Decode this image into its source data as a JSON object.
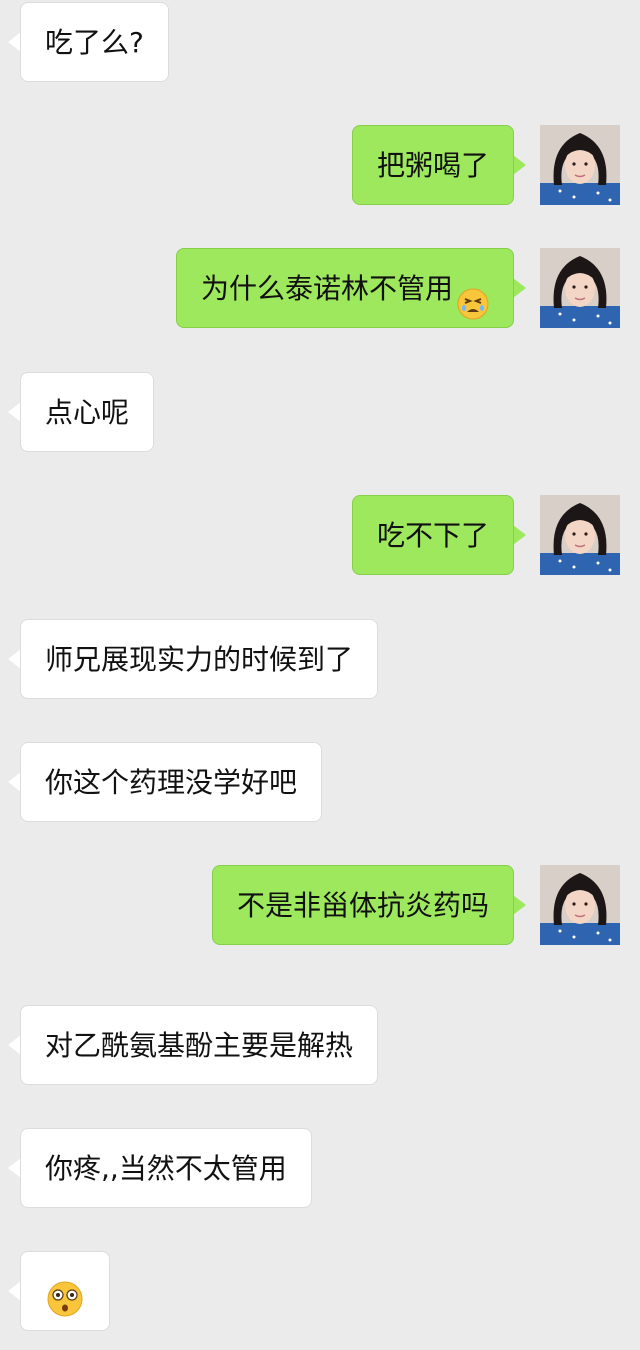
{
  "messages": [
    {
      "side": "left",
      "text": "吃了么?"
    },
    {
      "side": "right",
      "text": "把粥喝了"
    },
    {
      "side": "right",
      "text": "为什么泰诺林不管用",
      "emoji": "tired-face-emoji"
    },
    {
      "side": "left",
      "text": "点心呢"
    },
    {
      "side": "right",
      "text": "吃不下了"
    },
    {
      "side": "left",
      "text": "师兄展现实力的时候到了"
    },
    {
      "side": "left",
      "text": "你这个药理没学好吧"
    },
    {
      "side": "right",
      "text": "不是非甾体抗炎药吗"
    },
    {
      "side": "left",
      "text": "对乙酰氨基酚主要是解热"
    },
    {
      "side": "left",
      "text": "你疼,,当然不太管用"
    },
    {
      "side": "left",
      "text": "",
      "emoji": "astonished-face-emoji"
    }
  ],
  "colors": {
    "background": "#ebebeb",
    "incoming_bubble": "#ffffff",
    "outgoing_bubble": "#9ee85d"
  }
}
